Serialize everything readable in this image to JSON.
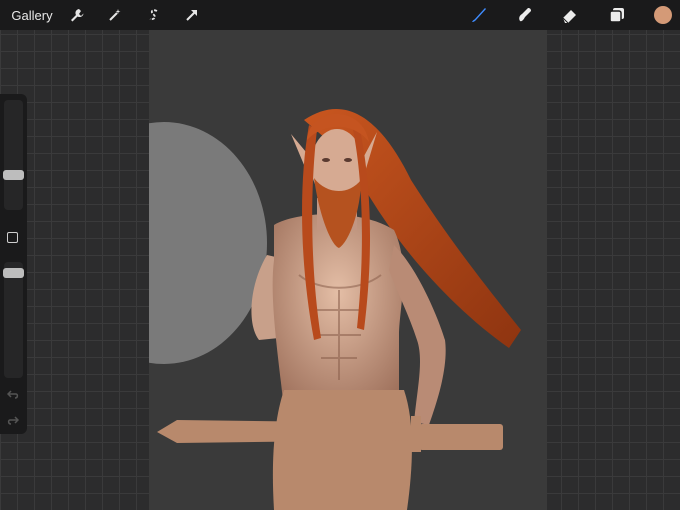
{
  "topbar": {
    "gallery_label": "Gallery",
    "actions_icon": "wrench-icon",
    "adjustments_icon": "magic-wand-icon",
    "selection_icon": "selection-s-icon",
    "transform_icon": "arrow-icon",
    "brush_icon": "brush-icon",
    "smudge_icon": "smudge-icon",
    "eraser_icon": "eraser-icon",
    "layers_icon": "layers-icon",
    "active_color": "#d49a77"
  },
  "sidebar": {
    "brush_size_level": 0.55,
    "opacity_level": 0.08,
    "modify_icon": "square-icon",
    "undo_icon": "undo-icon",
    "redo_icon": "redo-icon"
  },
  "colors": {
    "accent_blue": "#3f8cff",
    "skin": "#c79a80",
    "hair": "#b84a1c",
    "sword": "#b8896c",
    "shield": "#7a7a7a"
  }
}
